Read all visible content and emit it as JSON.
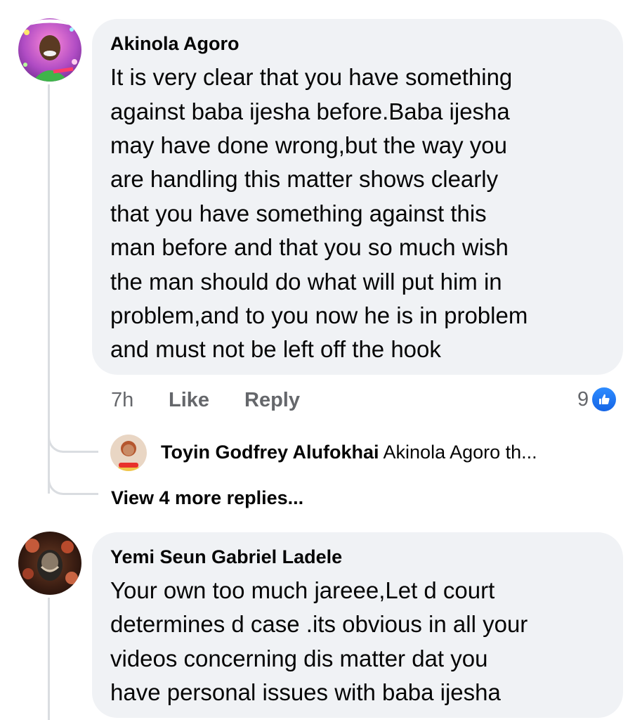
{
  "comments": [
    {
      "author": "Akinola Agoro",
      "lines": [
        "It is very clear that you have something",
        "against baba ijesha before.Baba ijesha",
        "may have done wrong,but the way you",
        "are handling this matter shows clearly",
        "that you have something against this",
        "man before and that you so much wish",
        "the man should do what will put him in",
        "problem,and to you now he is in problem",
        "and must not be left off the hook"
      ],
      "time": "7h",
      "like_label": "Like",
      "reply_label": "Reply",
      "reaction_count": "9",
      "reaction_icon": "like-icon",
      "reply_preview": {
        "author": "Toyin Godfrey Alufokhai",
        "text": "Akinola Agoro th..."
      },
      "view_more": "View 4 more replies..."
    },
    {
      "author": "Yemi Seun Gabriel Ladele",
      "lines": [
        "Your own too much jareee,Let d court",
        "determines d case .its obvious in all your",
        "videos concerning dis matter dat you",
        "have personal issues with baba ijesha"
      ]
    }
  ],
  "colors": {
    "bubble": "#f0f2f5",
    "meta": "#65676b",
    "like_blue": "#1877f2",
    "thread_line": "#dadde1"
  }
}
